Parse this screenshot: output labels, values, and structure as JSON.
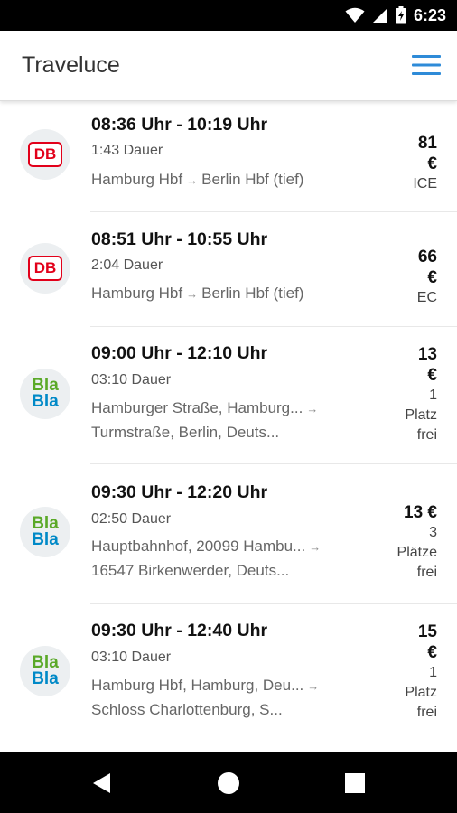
{
  "status_bar": {
    "time": "6:23",
    "icons": [
      "wifi-icon",
      "cell-signal-icon",
      "battery-charging-icon"
    ]
  },
  "app_bar": {
    "title": "Traveluce",
    "menu_icon": "hamburger-menu-icon",
    "accent_color": "#2e8bd8"
  },
  "connections": [
    {
      "provider": "DB",
      "logo_text": "DB",
      "times": "08:36 Uhr - 10:19 Uhr",
      "duration": "1:43 Dauer",
      "from": "Hamburg Hbf",
      "to": "Berlin Hbf (tief)",
      "price_lines": [
        "81",
        "€"
      ],
      "note_lines": [
        "ICE"
      ]
    },
    {
      "provider": "DB",
      "logo_text": "DB",
      "times": "08:51 Uhr - 10:55 Uhr",
      "duration": "2:04 Dauer",
      "from": "Hamburg Hbf",
      "to": "Berlin Hbf (tief)",
      "price_lines": [
        "66",
        "€"
      ],
      "note_lines": [
        "EC"
      ]
    },
    {
      "provider": "BlaBla",
      "logo_text_top": "Bla",
      "logo_text_bottom": "Bla",
      "times": "09:00 Uhr - 12:10 Uhr",
      "duration": "03:10 Dauer",
      "from": "Hamburger Straße, Hamburg...",
      "to": "Turmstraße, Berlin, Deuts...",
      "price_lines": [
        "13",
        "€"
      ],
      "note_lines": [
        "1",
        "Platz",
        "frei"
      ]
    },
    {
      "provider": "BlaBla",
      "logo_text_top": "Bla",
      "logo_text_bottom": "Bla",
      "times": "09:30 Uhr - 12:20 Uhr",
      "duration": "02:50 Dauer",
      "from": "Hauptbahnhof, 20099 Hambu...",
      "to": "16547 Birkenwerder, Deuts...",
      "price_lines": [
        "13 €"
      ],
      "note_lines": [
        "3",
        "Plätze",
        "frei"
      ]
    },
    {
      "provider": "BlaBla",
      "logo_text_top": "Bla",
      "logo_text_bottom": "Bla",
      "times": "09:30 Uhr - 12:40 Uhr",
      "duration": "03:10 Dauer",
      "from": "Hamburg Hbf, Hamburg, Deu...",
      "to": "Schloss Charlottenburg, S...",
      "price_lines": [
        "15",
        "€"
      ],
      "note_lines": [
        "1",
        "Platz",
        "frei"
      ]
    }
  ],
  "nav_bar": {
    "buttons": [
      "back-icon",
      "home-icon",
      "recents-icon"
    ]
  }
}
